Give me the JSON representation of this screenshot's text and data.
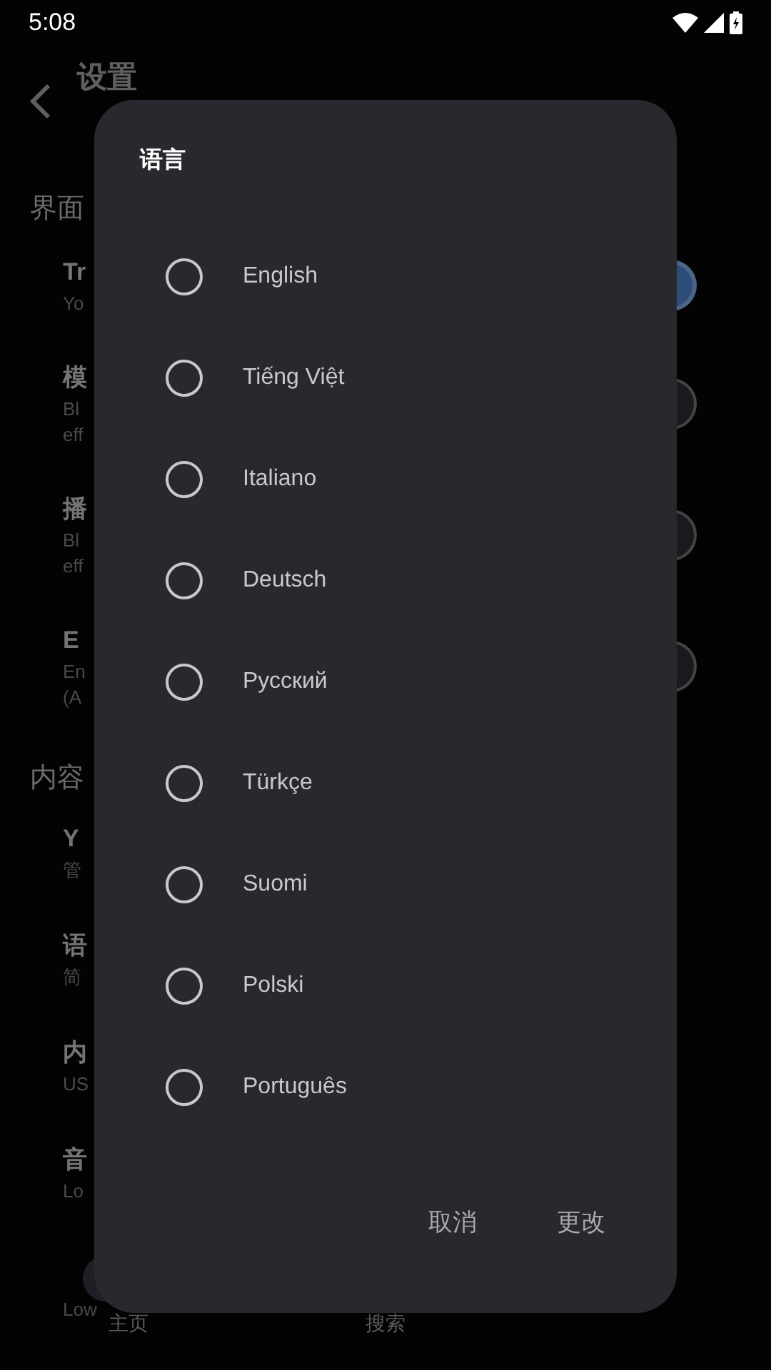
{
  "status_bar": {
    "time": "5:08"
  },
  "header": {
    "title": "设置"
  },
  "sections": [
    {
      "heading": "界面",
      "items": [
        {
          "kind": "switch",
          "title": "Tr",
          "subtitle": [
            "Yo"
          ],
          "on": true
        },
        {
          "kind": "switch",
          "title": "模",
          "subtitle": [
            "Bl",
            "eff"
          ],
          "on": false
        },
        {
          "kind": "switch",
          "title": "播",
          "subtitle": [
            "Bl",
            "eff"
          ],
          "on": false
        },
        {
          "kind": "switch",
          "title": "E",
          "subtitle": [
            "En",
            "(A"
          ],
          "on": false
        }
      ]
    },
    {
      "heading": "内容",
      "items": [
        {
          "kind": "link",
          "title": "Y",
          "subtitle": [
            "管"
          ]
        },
        {
          "kind": "link",
          "title": "语",
          "subtitle": [
            "简"
          ]
        },
        {
          "kind": "link",
          "title": "内",
          "subtitle": [
            "US"
          ]
        },
        {
          "kind": "link",
          "title": "音",
          "subtitle": [
            "Lo"
          ]
        },
        {
          "kind": "link",
          "subtitle": [
            "Low"
          ]
        }
      ]
    }
  ],
  "bottom_nav": [
    {
      "label": "主页",
      "selected": true
    },
    {
      "label": "搜索",
      "selected": false
    }
  ],
  "dialog": {
    "title": "语言",
    "options": [
      {
        "label": "English",
        "selected": false
      },
      {
        "label": "Tiếng Việt",
        "selected": false
      },
      {
        "label": "Italiano",
        "selected": false
      },
      {
        "label": "Deutsch",
        "selected": false
      },
      {
        "label": "Русский",
        "selected": false
      },
      {
        "label": "Türkçe",
        "selected": false
      },
      {
        "label": "Suomi",
        "selected": false
      },
      {
        "label": "Polski",
        "selected": false
      },
      {
        "label": "Português",
        "selected": false
      }
    ],
    "buttons": [
      "取消",
      "更改"
    ]
  }
}
